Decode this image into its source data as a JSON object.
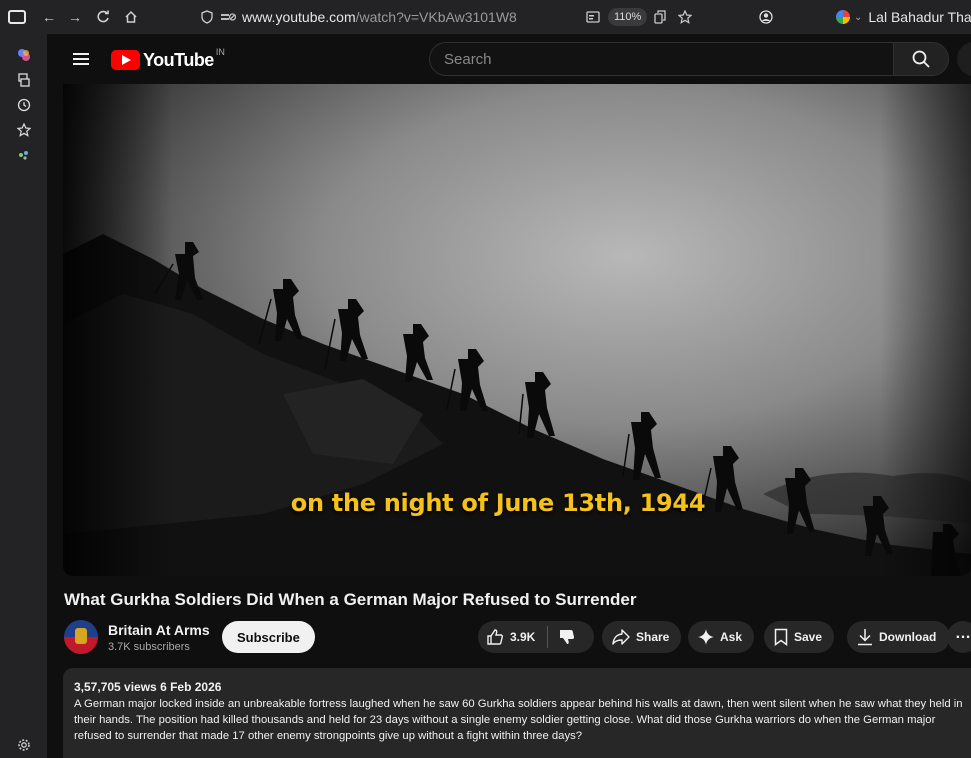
{
  "browser": {
    "url_host": "www.youtube.com",
    "url_path": "/watch?v=VKbAw3101W8",
    "zoom": "110%",
    "profile_name": "Lal Bahadur Tha"
  },
  "header": {
    "logo_text": "YouTube",
    "logo_region": "IN",
    "search_placeholder": "Search"
  },
  "video": {
    "caption": "on the night of June 13th, 1944",
    "title": "What Gurkha Soldiers Did When a German Major Refused to Surrender"
  },
  "channel": {
    "name": "Britain At Arms",
    "subscribers": "3.7K subscribers",
    "subscribe_label": "Subscribe"
  },
  "actions": {
    "likes": "3.9K",
    "share_label": "Share",
    "ask_label": "Ask",
    "save_label": "Save",
    "download_label": "Download",
    "more_label": "…"
  },
  "description": {
    "stats": "3,57,705 views  6 Feb 2026",
    "text": "A German major locked inside an unbreakable fortress laughed when he saw 60 Gurkha soldiers appear behind his walls at dawn, then went silent when he saw what they held in their hands. The position had killed thousands and held for 23 days without a single enemy soldier getting close. What did those Gurkha warriors do when the German major refused to surrender that made 17 other enemy strongpoints give up without a fight within three days?"
  },
  "colors": {
    "youtube_red": "#ff0000",
    "caption_yellow": "#f4c21a",
    "background": "#0f0f0f",
    "pill_bg": "#272727"
  }
}
